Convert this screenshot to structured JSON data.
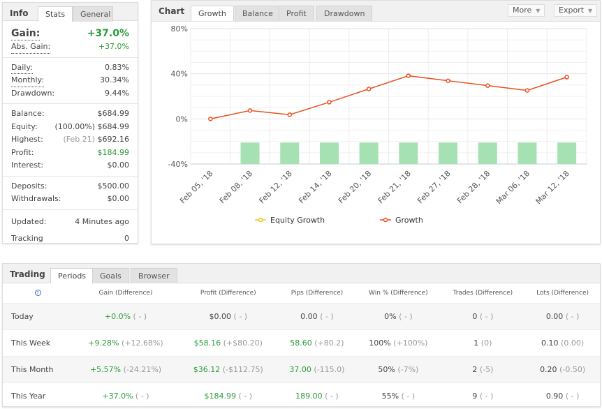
{
  "info": {
    "title": "Info",
    "tabs": [
      "Stats",
      "General"
    ],
    "gain_label": "Gain:",
    "gain_value": "+37.0%",
    "abs_gain_label": "Abs. Gain:",
    "abs_gain_value": "+37.0%",
    "daily_label": "Daily:",
    "daily_value": "0.83%",
    "monthly_label": "Monthly:",
    "monthly_value": "30.34%",
    "drawdown_label": "Drawdown:",
    "drawdown_value": "9.44%",
    "balance_label": "Balance:",
    "balance_value": "$684.99",
    "equity_label": "Equity:",
    "equity_pct": "(100.00%)",
    "equity_value": "$684.99",
    "highest_label": "Highest:",
    "highest_date": "(Feb 21)",
    "highest_value": "$692.16",
    "profit_label": "Profit:",
    "profit_value": "$184.99",
    "interest_label": "Interest:",
    "interest_value": "$0.00",
    "deposits_label": "Deposits:",
    "deposits_value": "$500.00",
    "withdrawals_label": "Withdrawals:",
    "withdrawals_value": "$0.00",
    "updated_label": "Updated:",
    "updated_value": "4 Minutes ago",
    "tracking_label": "Tracking",
    "tracking_value": "0"
  },
  "chart": {
    "title": "Chart",
    "tabs": [
      "Growth",
      "Balance",
      "Profit",
      "Drawdown"
    ],
    "more_label": "More",
    "export_label": "Export"
  },
  "chart_data": {
    "type": "line",
    "categories": [
      "Feb 05, '18",
      "Feb 08, '18",
      "Feb 12, '18",
      "Feb 14, '18",
      "Feb 20, '18",
      "Feb 21, '18",
      "Feb 27, '18",
      "Feb 28, '18",
      "Mar 06, '18",
      "Mar 12, '18"
    ],
    "yticks": [
      "80%",
      "40%",
      "0%",
      "-40%"
    ],
    "ylim": [
      -40,
      80
    ],
    "grid": true,
    "legend": "bottom",
    "series": [
      {
        "name": "Equity Growth",
        "color": "#f0c419",
        "values": []
      },
      {
        "name": "Growth",
        "color": "#e8501e",
        "values": [
          0,
          7.4,
          3.7,
          14.8,
          26.5,
          38.2,
          33.8,
          29.5,
          25.2,
          37.0
        ]
      }
    ],
    "bars": {
      "color": "#a6e1b3",
      "values": [
        null,
        -21,
        -21,
        -21,
        -21,
        -21,
        -21,
        -21,
        -21,
        -21
      ]
    }
  },
  "trading": {
    "title": "Trading",
    "tabs": [
      "Periods",
      "Goals",
      "Browser"
    ],
    "help_icon": "?",
    "headers": [
      "Gain (Difference)",
      "Profit (Difference)",
      "Pips (Difference)",
      "Win % (Difference)",
      "Trades (Difference)",
      "Lots (Difference)"
    ],
    "rows": [
      {
        "period": "Today",
        "cells": [
          [
            "+0.0%",
            "( - )",
            true
          ],
          [
            "$0.00",
            "( - )",
            false
          ],
          [
            "0.00",
            "( - )",
            false
          ],
          [
            "0%",
            "( - )",
            false
          ],
          [
            "0",
            "( - )",
            false
          ],
          [
            "0.00",
            "( - )",
            false
          ]
        ]
      },
      {
        "period": "This Week",
        "cells": [
          [
            "+9.28%",
            "(+12.68%)",
            true
          ],
          [
            "$58.16",
            "(+$80.20)",
            true
          ],
          [
            "58.60",
            "(+80.2)",
            true
          ],
          [
            "100%",
            "(+100%)",
            false
          ],
          [
            "1",
            "(0)",
            false
          ],
          [
            "0.10",
            "(0.00)",
            false
          ]
        ]
      },
      {
        "period": "This Month",
        "cells": [
          [
            "+5.57%",
            "(-24.21%)",
            true
          ],
          [
            "$36.12",
            "(-$112.75)",
            true
          ],
          [
            "37.00",
            "(-115.0)",
            true
          ],
          [
            "50%",
            "(-7%)",
            false
          ],
          [
            "2",
            "(-5)",
            false
          ],
          [
            "0.20",
            "(-0.50)",
            false
          ]
        ]
      },
      {
        "period": "This Year",
        "cells": [
          [
            "+37.0%",
            "( - )",
            true
          ],
          [
            "$184.99",
            "( - )",
            true
          ],
          [
            "189.00",
            "( - )",
            true
          ],
          [
            "55%",
            "( - )",
            false
          ],
          [
            "9",
            "( - )",
            false
          ],
          [
            "0.90",
            "( - )",
            false
          ]
        ]
      }
    ]
  }
}
